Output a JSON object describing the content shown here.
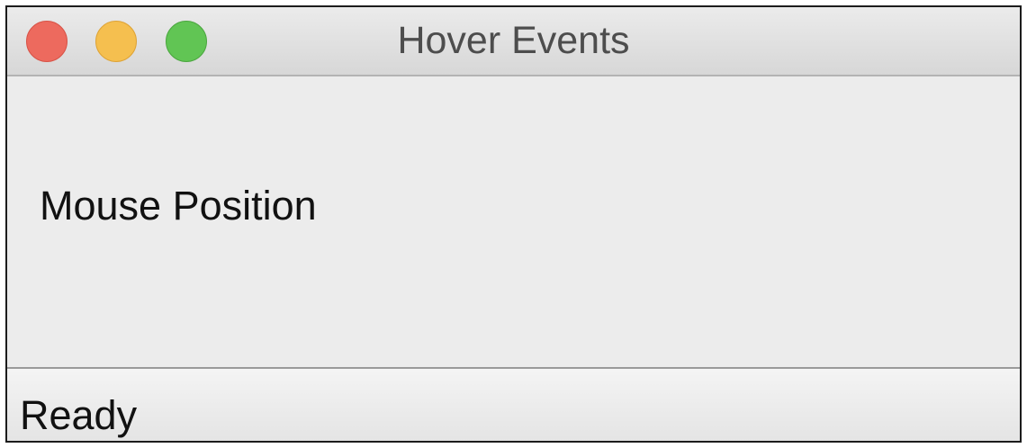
{
  "window": {
    "title": "Hover Events",
    "controls": {
      "close_icon": "close-circle-icon",
      "minimize_icon": "minimize-circle-icon",
      "zoom_icon": "zoom-circle-icon"
    },
    "colors": {
      "close": "#ed6a5e",
      "minimize": "#f5bf4f",
      "zoom": "#61c554"
    }
  },
  "main": {
    "mouse_position_label": "Mouse Position"
  },
  "statusbar": {
    "text": "Ready"
  }
}
